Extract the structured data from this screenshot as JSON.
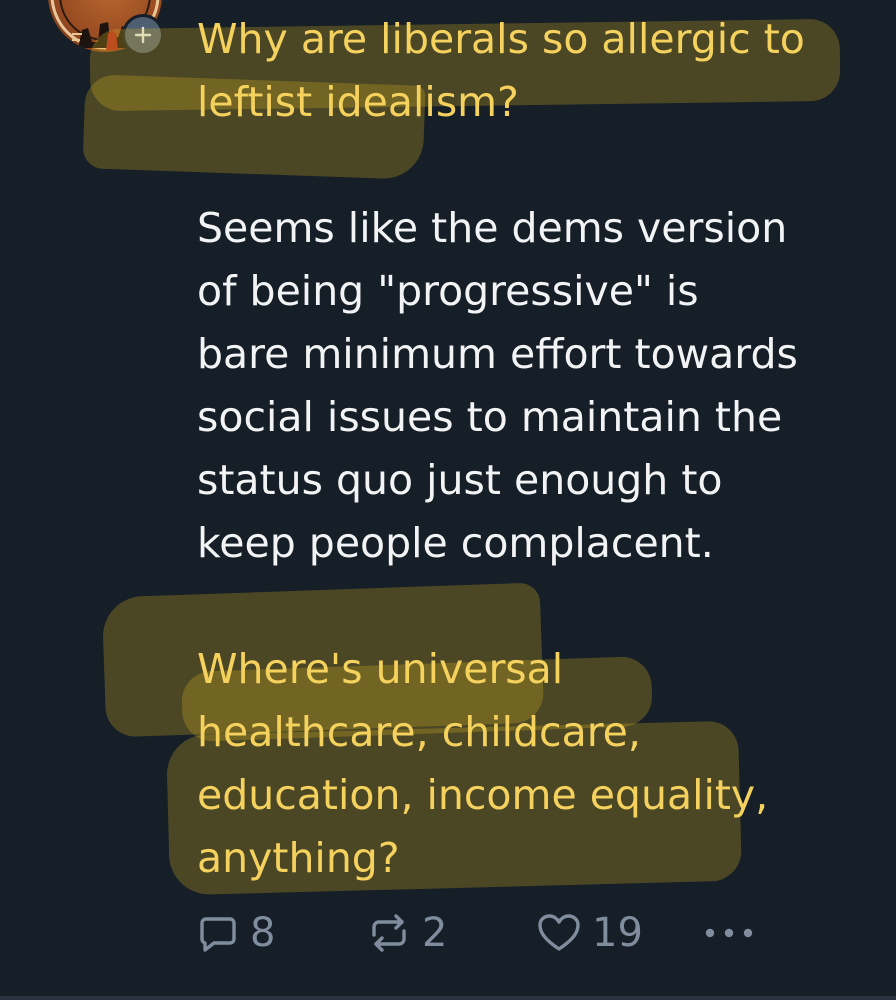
{
  "post": {
    "paragraphs": [
      {
        "highlight": "yellow",
        "lines": [
          "Why are liberals so allergic to",
          "leftist idealism?"
        ]
      },
      {
        "highlight": "none",
        "lines": [
          "Seems like the dems version",
          "of being \"progressive\" is",
          "bare minimum effort towards",
          "social issues to maintain the",
          "status quo just enough to",
          "keep people complacent."
        ]
      },
      {
        "highlight": "yellow",
        "lines": [
          "Where's universal",
          "healthcare, childcare,",
          "education, income equality,",
          "anything?"
        ]
      }
    ]
  },
  "actions": {
    "reply_count": "8",
    "repost_count": "2",
    "like_count": "19"
  },
  "icons": {
    "avatar": "avatar",
    "follow": "plus-icon",
    "reply": "reply-bubble-icon",
    "repost": "repost-icon",
    "like": "heart-icon",
    "more": "more-dots-icon"
  },
  "colors": {
    "background": "#161e27",
    "text": "#f2f3f5",
    "highlighted_text": "#f5d15e",
    "highlight_marker": "#d6b51f",
    "action_gray": "#7f8d9e"
  }
}
